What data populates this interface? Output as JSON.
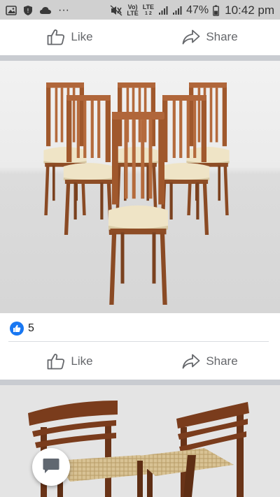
{
  "status_bar": {
    "battery_percent": "47%",
    "time": "10:42 pm",
    "overflow": "···",
    "volte_top": "Vo)",
    "volte_bottom": "LTE",
    "lte_top": "LTE",
    "lte_bottom": "1 2",
    "icons": [
      "image-icon",
      "shield-icon",
      "cloud-icon",
      "mute-icon",
      "signal-icon",
      "signal-icon",
      "battery-icon"
    ]
  },
  "post1": {
    "like_label": "Like",
    "share_label": "Share"
  },
  "post2": {
    "image_subject": "chairs",
    "reaction_count": "5",
    "like_label": "Like",
    "share_label": "Share"
  },
  "post3": {
    "image_subject": "chairs"
  },
  "colors": {
    "brand_blue": "#1877f2",
    "action_gray": "#65676b",
    "divider": "#c9ccd1"
  }
}
